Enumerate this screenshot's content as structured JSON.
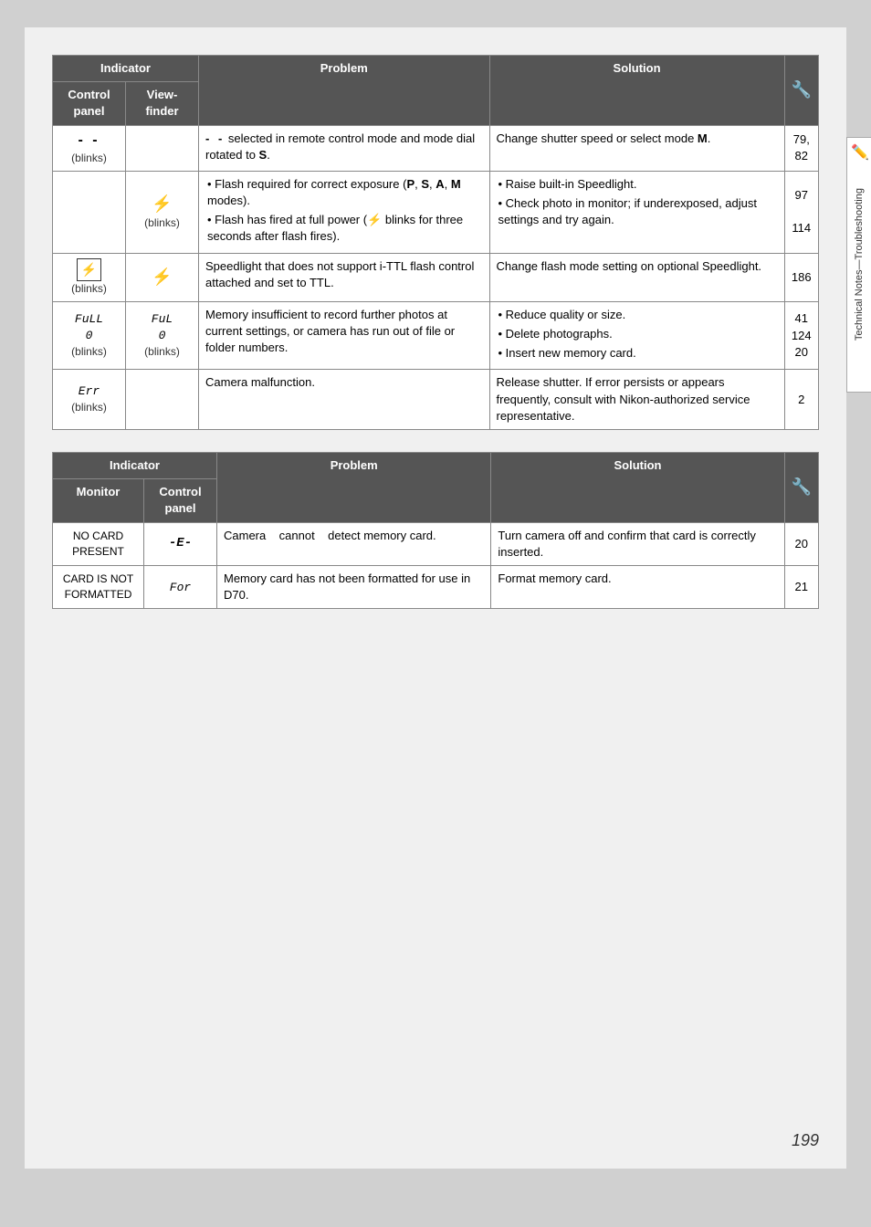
{
  "page": {
    "number": "199",
    "sidebar_label": "Technical Notes—Troubleshooting"
  },
  "table1": {
    "indicator_label": "Indicator",
    "col_control": "Control panel",
    "col_viewfinder": "View-finder",
    "col_problem": "Problem",
    "col_solution": "Solution",
    "rows": [
      {
        "control": "- -\n(blinks)",
        "viewfinder": "",
        "problem": "- - selected in remote control mode and mode dial rotated to S.",
        "solution": "Change shutter speed or select mode M.",
        "page": "79,\n82"
      },
      {
        "control": "",
        "viewfinder": "⚡\n(blinks)",
        "problem_bullets": [
          "Flash required for correct exposure (P, S, A, M modes).",
          "Flash has fired at full power (⚡ blinks for three seconds after flash fires)."
        ],
        "solution_bullets": [
          "Raise built-in Speedlight.",
          "Check photo in monitor; if underexposed, adjust settings and try again."
        ],
        "page": "97\n114"
      },
      {
        "control": "⚡\n(blinks)",
        "viewfinder": "⚡",
        "problem": "Speedlight that does not support i-TTL flash control attached and set to TTL.",
        "solution": "Change flash mode setting on optional Speedlight.",
        "page": "186"
      },
      {
        "control": "FuLL\n0\n(blinks)",
        "viewfinder": "FuL\n0\n(blinks)",
        "problem": "Memory insufficient to record further photos at current settings, or camera has run out of file or folder numbers.",
        "solution_bullets": [
          "Reduce quality or size.",
          "Delete photographs.",
          "Insert new memory card."
        ],
        "page": "41\n124\n20"
      },
      {
        "control": "Err\n(blinks)",
        "viewfinder": "",
        "problem": "Camera malfunction.",
        "solution": "Release shutter. If error persists or appears frequently, consult with Nikon-authorized service representative.",
        "page": "2"
      }
    ]
  },
  "table2": {
    "indicator_label": "Indicator",
    "col_monitor": "Monitor",
    "col_control": "Control panel",
    "col_problem": "Problem",
    "col_solution": "Solution",
    "rows": [
      {
        "monitor": "NO CARD\nPRESENT",
        "control": "-E-",
        "problem": "Camera cannot detect memory card.",
        "solution": "Turn camera off and confirm that card is correctly inserted.",
        "page": "20"
      },
      {
        "monitor": "CARD IS NOT\nFORMATTED",
        "control": "For",
        "problem": "Memory card has not been formatted for use in D70.",
        "solution": "Format memory card.",
        "page": "21"
      }
    ]
  }
}
